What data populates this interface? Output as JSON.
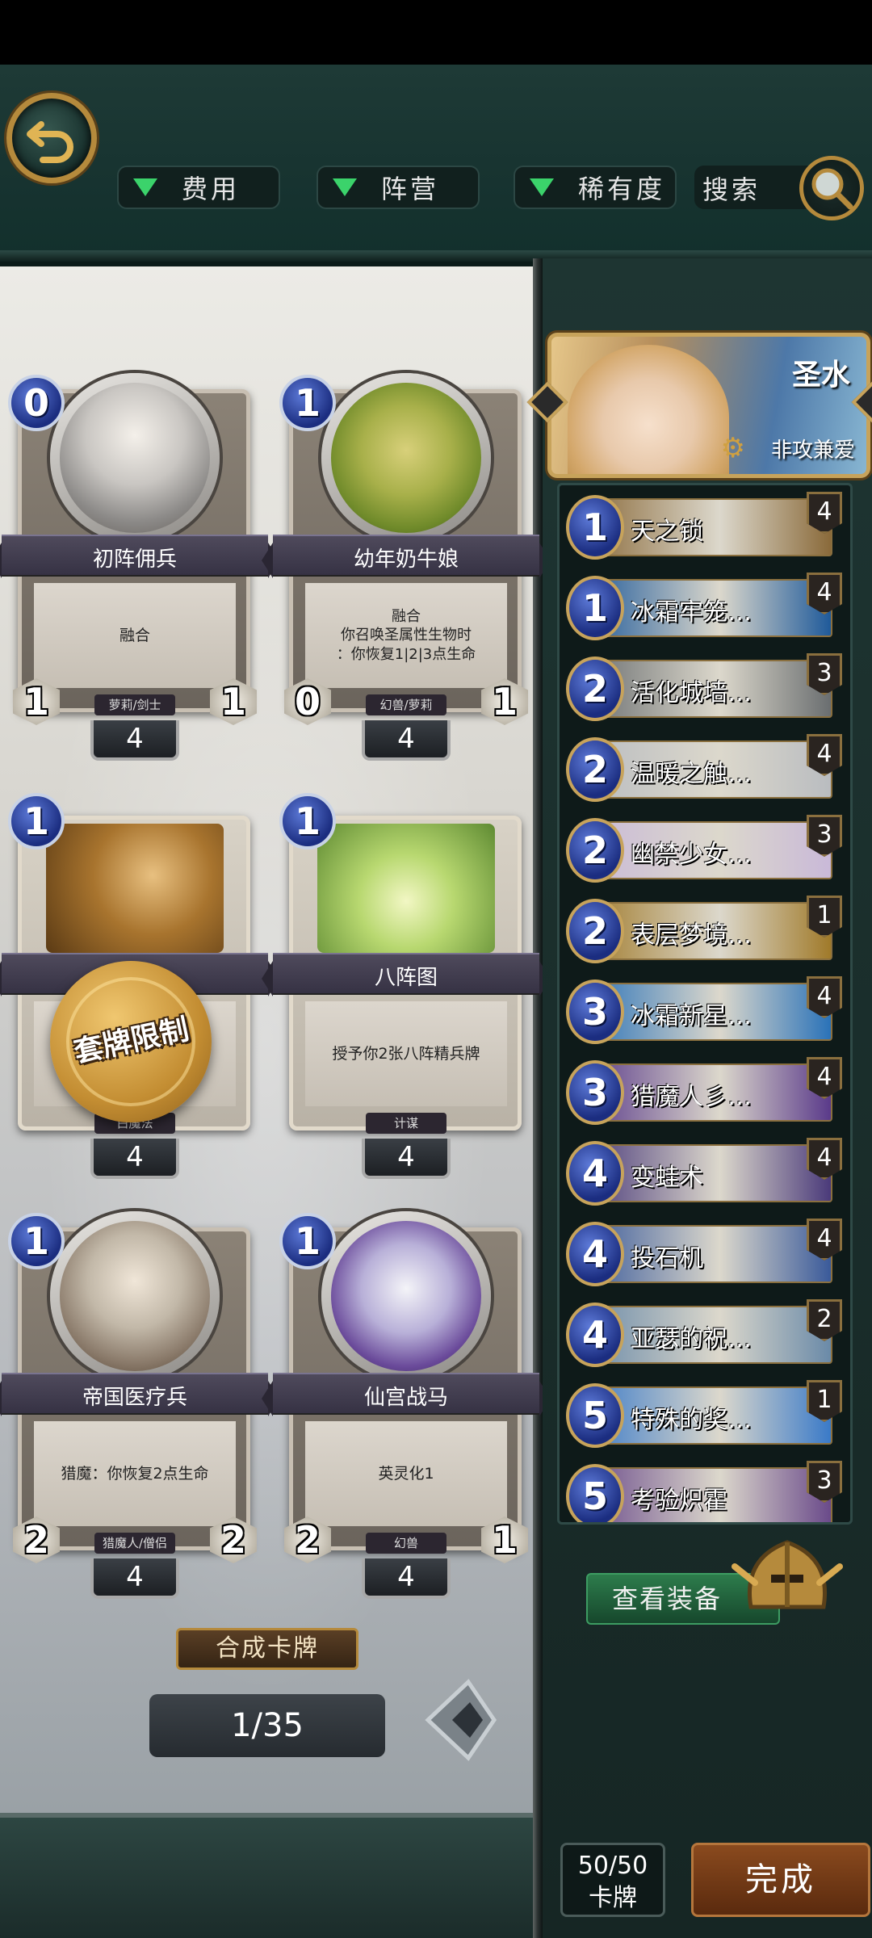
{
  "filters": {
    "cost": "费用",
    "faction": "阵营",
    "rarity": "稀有度",
    "search": "搜索"
  },
  "cards": [
    {
      "cost": "0",
      "name": "初阵佣兵",
      "desc": "融合",
      "tribe": "萝莉/剑士",
      "atk": "1",
      "hp": "1",
      "count": "4"
    },
    {
      "cost": "1",
      "name": "幼年奶牛娘",
      "desc": "融合\n你召唤圣属性生物时\n：你恢复1|2|3点生命",
      "tribe": "幻兽/萝莉",
      "atk": "0",
      "hp": "1",
      "count": "4"
    },
    {
      "cost": "1",
      "name": "",
      "desc": "",
      "tribe": "白魔法",
      "atk": "",
      "hp": "",
      "count": "4"
    },
    {
      "cost": "1",
      "name": "八阵图",
      "desc": "授予你2张八阵精兵牌",
      "tribe": "计谋",
      "atk": "",
      "hp": "",
      "count": "4"
    },
    {
      "cost": "1",
      "name": "帝国医疗兵",
      "desc": "猎魔：你恢复2点生命",
      "tribe": "猎魔人/僧侣",
      "atk": "2",
      "hp": "2",
      "count": "4"
    },
    {
      "cost": "1",
      "name": "仙宫战马",
      "desc": "英灵化1",
      "tribe": "幻兽",
      "atk": "2",
      "hp": "1",
      "count": "4"
    }
  ],
  "seal_text": "套牌限制",
  "craft_label": "合成卡牌",
  "page_indicator": "1/35",
  "hero": {
    "name": "圣水",
    "skill": "非攻兼爱"
  },
  "deck": [
    {
      "cost": "1",
      "name": "天之锁",
      "count": "4",
      "color": "#8a6a3a"
    },
    {
      "cost": "1",
      "name": "冰霜牢笼…",
      "count": "4",
      "color": "#1f5a9a"
    },
    {
      "cost": "2",
      "name": "活化城墙…",
      "count": "3",
      "color": "#6a6e70"
    },
    {
      "cost": "2",
      "name": "温暖之触…",
      "count": "4",
      "color": "#b9bcc0"
    },
    {
      "cost": "2",
      "name": "幽禁少女…",
      "count": "3",
      "color": "#c9b9d8"
    },
    {
      "cost": "2",
      "name": "表层梦境…",
      "count": "1",
      "color": "#a07a2a"
    },
    {
      "cost": "3",
      "name": "冰霜新星…",
      "count": "4",
      "color": "#2a72b8"
    },
    {
      "cost": "3",
      "name": "猎魔人彡…",
      "count": "4",
      "color": "#5a3a8a"
    },
    {
      "cost": "4",
      "name": "变蛙术",
      "count": "4",
      "color": "#4a3a7a"
    },
    {
      "cost": "4",
      "name": "投石机",
      "count": "4",
      "color": "#3a5a9a"
    },
    {
      "cost": "4",
      "name": "亚瑟的祝…",
      "count": "2",
      "color": "#6a8aa8"
    },
    {
      "cost": "5",
      "name": "特殊的奖…",
      "count": "1",
      "color": "#3a7ac8"
    },
    {
      "cost": "5",
      "name": "考验炽霍",
      "count": "3",
      "color": "#6a4a8a"
    }
  ],
  "equip_label": "查看装备",
  "deck_count": {
    "value": "50/50",
    "label": "卡牌"
  },
  "done_label": "完成"
}
